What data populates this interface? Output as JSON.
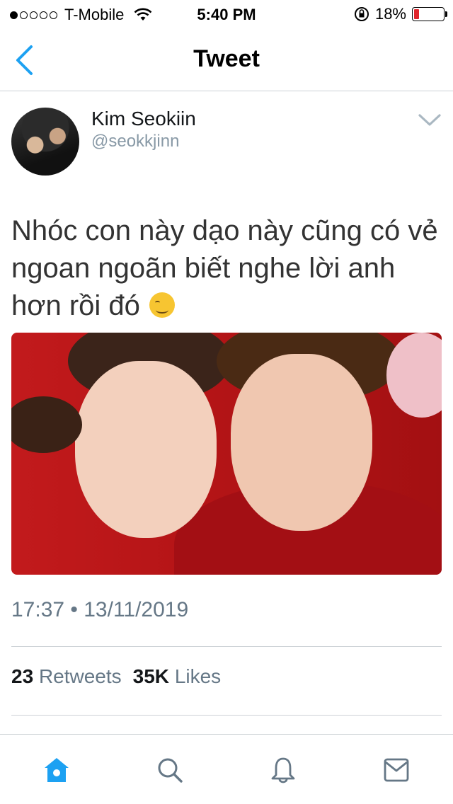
{
  "status_bar": {
    "carrier": "T-Mobile",
    "time": "5:40 PM",
    "battery": "18%",
    "battery_level": 0.18,
    "signal_bars": 1
  },
  "nav": {
    "title": "Tweet"
  },
  "tweet": {
    "author_name": "Kim Seokiin",
    "author_handle": "@seokkjinn",
    "text": "Nhóc con này dạo này cũng có vẻ ngoan ngoãn biết nghe lời anh hơn rồi đó",
    "timestamp": "17:37 • 13/11/2019",
    "retweets_count": "23",
    "retweets_label": "Retweets",
    "likes_count": "35K",
    "likes_label": "Likes"
  },
  "tab_bar": {
    "items": [
      "home-icon",
      "search-icon",
      "notifications-icon",
      "messages-icon"
    ]
  },
  "colors": {
    "accent": "#1da1f2",
    "text_secondary": "#657786",
    "battery_low": "#e0242b"
  }
}
